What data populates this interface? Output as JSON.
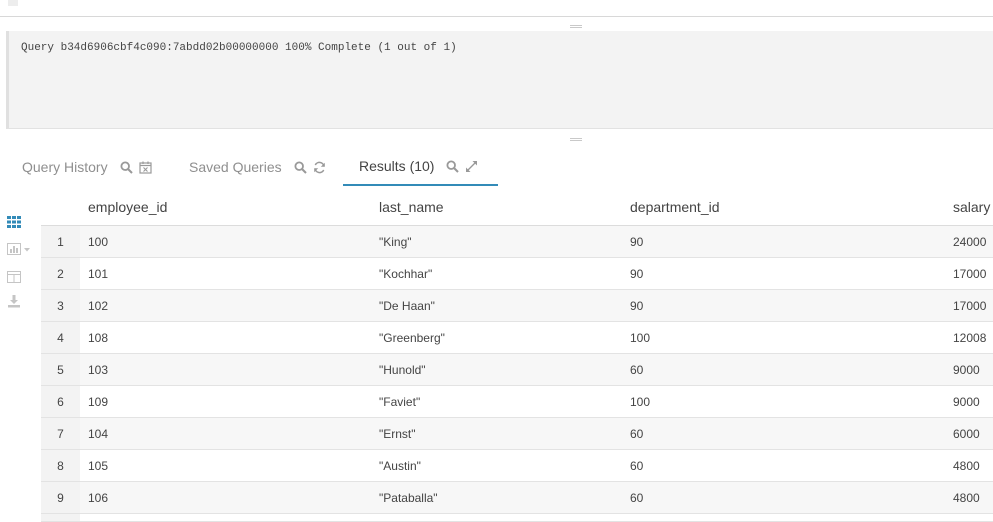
{
  "log": {
    "line": "Query b34d6906cbf4c090:7abdd02b00000000 100% Complete (1 out of 1)"
  },
  "tabs": {
    "history_label": "Query History",
    "saved_label": "Saved Queries",
    "results_label": "Results (10)",
    "accent_color": "#338bb8"
  },
  "table": {
    "headers": {
      "employee_id": "employee_id",
      "last_name": "last_name",
      "department_id": "department_id",
      "salary": "salary"
    },
    "rows": [
      {
        "n": "1",
        "employee_id": "100",
        "last_name": "\"King\"",
        "department_id": "90",
        "salary": "24000"
      },
      {
        "n": "2",
        "employee_id": "101",
        "last_name": "\"Kochhar\"",
        "department_id": "90",
        "salary": "17000"
      },
      {
        "n": "3",
        "employee_id": "102",
        "last_name": "\"De Haan\"",
        "department_id": "90",
        "salary": "17000"
      },
      {
        "n": "4",
        "employee_id": "108",
        "last_name": "\"Greenberg\"",
        "department_id": "100",
        "salary": "12008"
      },
      {
        "n": "5",
        "employee_id": "103",
        "last_name": "\"Hunold\"",
        "department_id": "60",
        "salary": "9000"
      },
      {
        "n": "6",
        "employee_id": "109",
        "last_name": "\"Faviet\"",
        "department_id": "100",
        "salary": "9000"
      },
      {
        "n": "7",
        "employee_id": "104",
        "last_name": "\"Ernst\"",
        "department_id": "60",
        "salary": "6000"
      },
      {
        "n": "8",
        "employee_id": "105",
        "last_name": "\"Austin\"",
        "department_id": "60",
        "salary": "4800"
      },
      {
        "n": "9",
        "employee_id": "106",
        "last_name": "\"Pataballa\"",
        "department_id": "60",
        "salary": "4800"
      }
    ]
  }
}
